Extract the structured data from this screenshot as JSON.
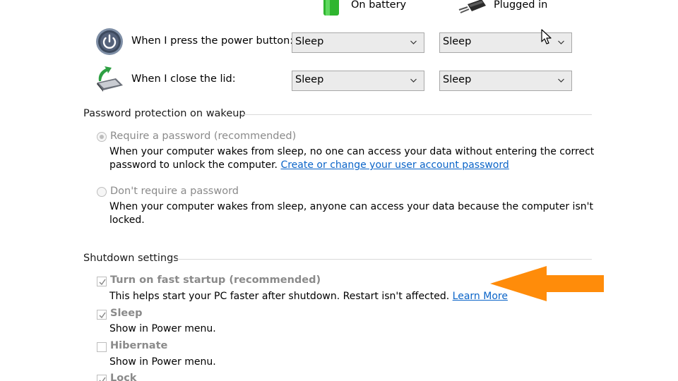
{
  "columns": {
    "battery": "On battery",
    "plugged": "Plugged in"
  },
  "power_button": {
    "label": "When I press the power button:",
    "battery_value": "Sleep",
    "plugged_value": "Sleep"
  },
  "lid": {
    "label": "When I close the lid:",
    "battery_value": "Sleep",
    "plugged_value": "Sleep"
  },
  "password": {
    "heading": "Password protection on wakeup",
    "require": {
      "label": "Require a password (recommended)",
      "desc_line1": "When your computer wakes from sleep, no one can access your data without entering the correct",
      "desc_line2": "password to unlock the computer.",
      "link": "Create or change your user account password"
    },
    "dont_require": {
      "label": "Don't require a password",
      "desc_line1": "When your computer wakes from sleep, anyone can access your data because the computer isn't",
      "desc_line2": "locked."
    }
  },
  "shutdown": {
    "heading": "Shutdown settings",
    "fast_startup": {
      "label": "Turn on fast startup (recommended)",
      "desc": "This helps start your PC faster after shutdown. Restart isn't affected.",
      "link": "Learn More",
      "checked": true
    },
    "sleep": {
      "label": "Sleep",
      "desc": "Show in Power menu.",
      "checked": true
    },
    "hibernate": {
      "label": "Hibernate",
      "desc": "Show in Power menu.",
      "checked": false
    },
    "lock": {
      "label": "Lock",
      "checked": true
    }
  },
  "colors": {
    "arrow": "#ff8c0a",
    "link": "#0a64c8",
    "disabled_text": "#8a8a8a"
  }
}
